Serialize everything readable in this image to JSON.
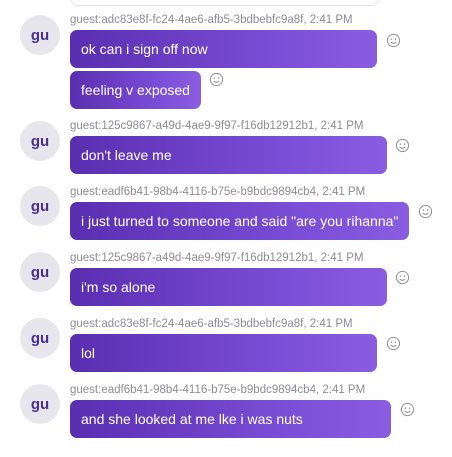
{
  "messages": [
    {
      "avatar": "gu",
      "meta": "guest:adc83e8f-fc24-4ae6-afb5-3bdbebfc9a8f, 2:41 PM",
      "texts": [
        "ok can i sign off now",
        "feeling v exposed"
      ]
    },
    {
      "avatar": "gu",
      "meta": "guest:125c9867-a49d-4ae9-9f97-f16db12912b1, 2:41 PM",
      "texts": [
        "don't leave me"
      ]
    },
    {
      "avatar": "gu",
      "meta": "guest:eadf6b41-98b4-4116-b75e-b9bdc9894cb4, 2:41 PM",
      "texts": [
        "i just turned to someone and said \"are you rihanna\""
      ]
    },
    {
      "avatar": "gu",
      "meta": "guest:125c9867-a49d-4ae9-9f97-f16db12912b1, 2:41 PM",
      "texts": [
        "i'm so alone"
      ]
    },
    {
      "avatar": "gu",
      "meta": "guest:adc83e8f-fc24-4ae6-afb5-3bdbebfc9a8f, 2:41 PM",
      "texts": [
        "lol"
      ]
    },
    {
      "avatar": "gu",
      "meta": "guest:eadf6b41-98b4-4116-b75e-b9bdc9894cb4, 2:41 PM",
      "texts": [
        "and she looked at me lke i was nuts"
      ]
    }
  ],
  "icons": {
    "reaction": "smiley-icon"
  },
  "colors": {
    "bubble_start": "#5a2eb0",
    "bubble_end": "#8a5ce0",
    "avatar_bg": "#e7e6ec",
    "avatar_text": "#4b2f8f"
  }
}
